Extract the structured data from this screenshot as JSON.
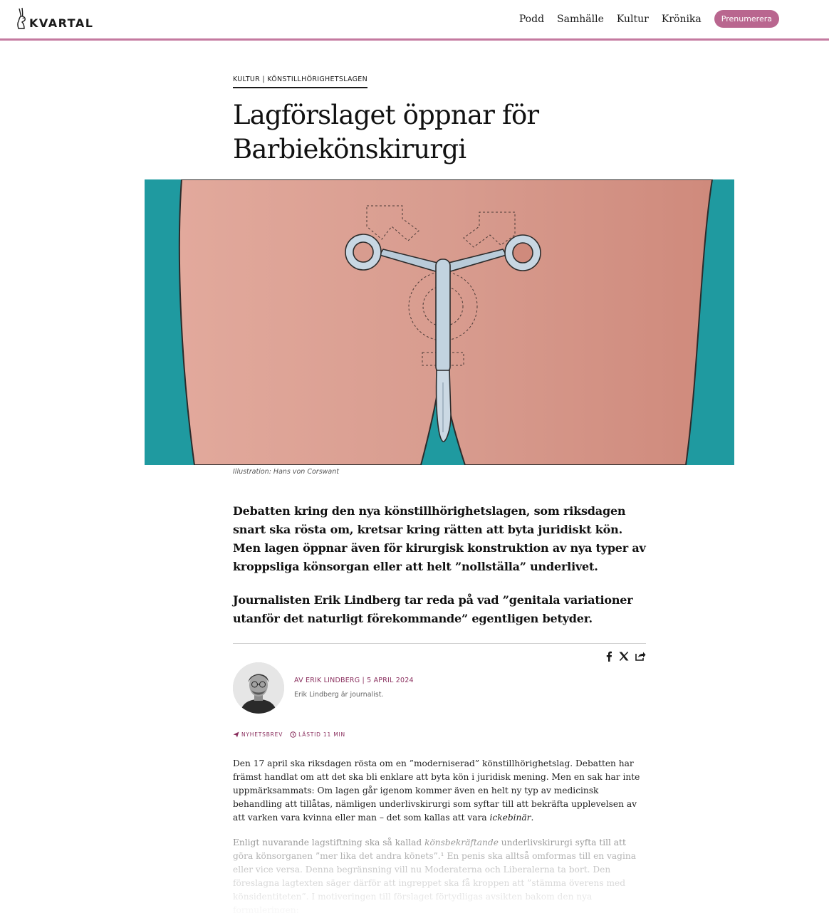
{
  "header": {
    "logo_text": "KVARTAL",
    "nav": [
      "Podd",
      "Samhälle",
      "Kultur",
      "Krönika"
    ],
    "subscribe_label": "Prenumerera",
    "accent_color": "#c47aa0"
  },
  "article": {
    "kicker": "KULTUR | KÖNSTILLHÖRIGHETSLAGEN",
    "title": "Lagförslaget öppnar för Barbiekönskirurgi",
    "image_caption": "Illustration: Hans von Corswant",
    "lead": [
      "Debatten kring den nya könstillhörighetslagen, som riksdagen snart ska rösta om, kretsar kring rätten att byta juridiskt kön. Men lagen öppnar även för kirurgisk konstruktion av nya typer av kroppsliga könsorgan eller att helt ”nollställa” underlivet.",
      "Journalisten Erik Lindberg tar reda på vad ”genitala variationer utanför det naturligt förekommande” egentligen betyder."
    ],
    "share_icons": [
      "facebook-icon",
      "x-icon",
      "share-icon"
    ],
    "byline": {
      "author": "AV ERIK LINDBERG",
      "separator": " | ",
      "date": "5 APRIL 2024",
      "bio": "Erik Lindberg är journalist."
    },
    "meta": {
      "newsletter": "NYHETSBREV",
      "reading_time": "LÄSTID 11 MIN"
    },
    "body": [
      {
        "a": "Den 17 april ska riksdagen rösta om en ”moderniserad” könstillhörighetslag. Debatten har främst handlat om att det ska bli enklare att byta kön i juridisk mening. Men en sak har inte uppmärksammats: Om lagen går igenom kommer även en helt ny typ av medicinsk behandling att tillåtas, nämligen underlivskirurgi som syftar till att bekräfta upplevelsen av att varken vara kvinna eller man – det som kallas att vara ",
        "em": "ickebinär",
        "b": "."
      },
      {
        "a": "Enligt nuvarande lagstiftning ska så kallad ",
        "em": "könsbekräftande",
        "b": " underlivskirurgi syfta till att göra könsorganen ”mer lika det andra könets”.¹ En penis ska alltså omformas till en vagina eller vice versa. Denna begränsning vill nu Moderaterna och Liberalerna ta bort. Den föreslagna lagtexten säger därför att ingreppet ska få kroppen att ”stämma överens med könsidentiteten”. I motiveringen till förslaget förtydligas avsikten bakom den nya formuleringen:"
      }
    ]
  }
}
